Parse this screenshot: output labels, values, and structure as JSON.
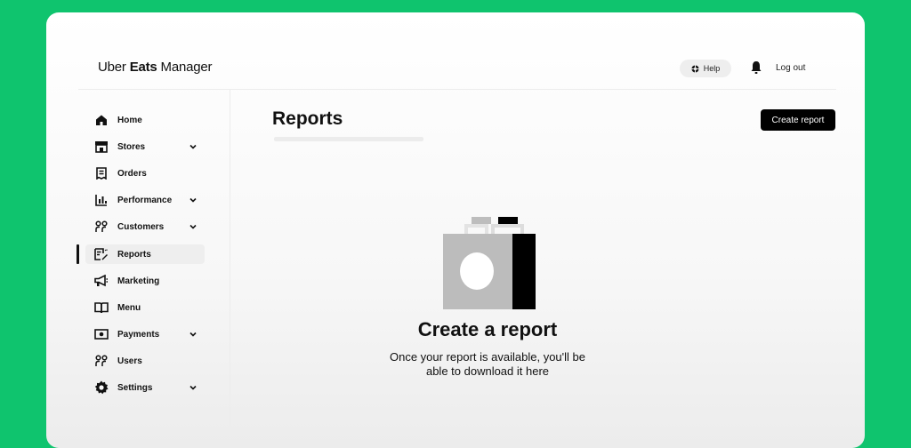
{
  "header": {
    "brand_light": "Uber ",
    "brand_bold": "Eats",
    "brand_rest": " Manager",
    "help_label": "Help",
    "logout_label": "Log out"
  },
  "sidebar": {
    "items": [
      {
        "label": "Home",
        "icon": "home-icon",
        "expandable": false
      },
      {
        "label": "Stores",
        "icon": "store-icon",
        "expandable": true
      },
      {
        "label": "Orders",
        "icon": "receipt-icon",
        "expandable": false
      },
      {
        "label": "Performance",
        "icon": "bar-chart-icon",
        "expandable": true
      },
      {
        "label": "Customers",
        "icon": "customers-icon",
        "expandable": true
      },
      {
        "label": "Reports",
        "icon": "reports-icon",
        "expandable": false,
        "active": true
      },
      {
        "label": "Marketing",
        "icon": "megaphone-icon",
        "expandable": false
      },
      {
        "label": "Menu",
        "icon": "book-icon",
        "expandable": false
      },
      {
        "label": "Payments",
        "icon": "payments-icon",
        "expandable": true
      },
      {
        "label": "Users",
        "icon": "users-icon",
        "expandable": false
      },
      {
        "label": "Settings",
        "icon": "gear-icon",
        "expandable": true
      }
    ]
  },
  "main": {
    "title": "Reports",
    "create_button": "Create report",
    "empty_state": {
      "title": "Create a report",
      "subtitle_line1": "Once your report is available, you'll be",
      "subtitle_line2": "able to download it here"
    }
  },
  "colors": {
    "background": "#0fc46e",
    "accent": "#000000",
    "active_item": "#eeeeee"
  }
}
